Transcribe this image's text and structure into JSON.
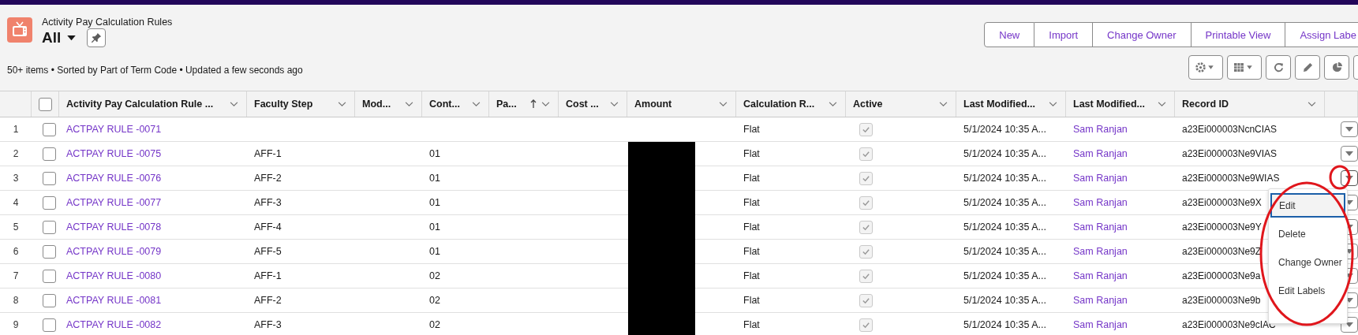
{
  "header": {
    "object_label": "Activity Pay Calculation Rules",
    "list_view": "All"
  },
  "actions": [
    "New",
    "Import",
    "Change Owner",
    "Printable View",
    "Assign Labe"
  ],
  "select_all": {
    "checked": false
  },
  "status": "50+ items • Sorted by Part of Term Code • Updated a few seconds ago",
  "columns": [
    {
      "label": "Activity Pay Calculation Rule ...",
      "sorted": false
    },
    {
      "label": "Faculty Step",
      "sorted": false
    },
    {
      "label": "Mod...",
      "sorted": false
    },
    {
      "label": "Cont...",
      "sorted": false
    },
    {
      "label": "Pa...",
      "sorted": true
    },
    {
      "label": "Cost ...",
      "sorted": false
    },
    {
      "label": "Amount",
      "sorted": false
    },
    {
      "label": "Calculation R...",
      "sorted": false
    },
    {
      "label": "Active",
      "sorted": false
    },
    {
      "label": "Last Modified...",
      "sorted": false
    },
    {
      "label": "Last Modified...",
      "sorted": false
    },
    {
      "label": "Record ID",
      "sorted": false
    }
  ],
  "rows": [
    {
      "num": "1",
      "checked": false,
      "name": "ACTPAY RULE -0071",
      "amount_redacted": false,
      "calc": "Flat",
      "active": true,
      "modified": "5/1/2024 10:35 A...",
      "modified_by": "Sam Ranjan",
      "record_id": "a23Ei000003NcnCIAS",
      "menu_open": false
    },
    {
      "num": "2",
      "checked": false,
      "name": "ACTPAY RULE -0075",
      "faculty_step": "AFF-1",
      "contract": "01",
      "amount_redacted": true,
      "calc": "Flat",
      "active": true,
      "modified": "5/1/2024 10:35 A...",
      "modified_by": "Sam Ranjan",
      "record_id": "a23Ei000003Ne9VIAS",
      "menu_open": false
    },
    {
      "num": "3",
      "checked": false,
      "name": "ACTPAY RULE -0076",
      "faculty_step": "AFF-2",
      "contract": "01",
      "amount_redacted": true,
      "calc": "Flat",
      "active": true,
      "modified": "5/1/2024 10:35 A...",
      "modified_by": "Sam Ranjan",
      "record_id": "a23Ei000003Ne9WIAS",
      "menu_open": true
    },
    {
      "num": "4",
      "checked": false,
      "name": "ACTPAY RULE -0077",
      "faculty_step": "AFF-3",
      "contract": "01",
      "amount_redacted": true,
      "calc": "Flat",
      "active": true,
      "modified": "5/1/2024 10:35 A...",
      "modified_by": "Sam Ranjan",
      "record_id": "a23Ei000003Ne9X",
      "menu_open": false
    },
    {
      "num": "5",
      "checked": false,
      "name": "ACTPAY RULE -0078",
      "faculty_step": "AFF-4",
      "contract": "01",
      "amount_redacted": true,
      "calc": "Flat",
      "active": true,
      "modified": "5/1/2024 10:35 A...",
      "modified_by": "Sam Ranjan",
      "record_id": "a23Ei000003Ne9Y",
      "menu_open": false
    },
    {
      "num": "6",
      "checked": false,
      "name": "ACTPAY RULE -0079",
      "faculty_step": "AFF-5",
      "contract": "01",
      "amount_redacted": true,
      "calc": "Flat",
      "active": true,
      "modified": "5/1/2024 10:35 A...",
      "modified_by": "Sam Ranjan",
      "record_id": "a23Ei000003Ne9Z",
      "menu_open": false
    },
    {
      "num": "7",
      "checked": false,
      "name": "ACTPAY RULE -0080",
      "faculty_step": "AFF-1",
      "contract": "02",
      "amount_redacted": true,
      "calc": "Flat",
      "active": true,
      "modified": "5/1/2024 10:35 A...",
      "modified_by": "Sam Ranjan",
      "record_id": "a23Ei000003Ne9a",
      "menu_open": false
    },
    {
      "num": "8",
      "checked": false,
      "name": "ACTPAY RULE -0081",
      "faculty_step": "AFF-2",
      "contract": "02",
      "amount_redacted": true,
      "calc": "Flat",
      "active": true,
      "modified": "5/1/2024 10:35 A...",
      "modified_by": "Sam Ranjan",
      "record_id": "a23Ei000003Ne9b",
      "menu_open": false
    },
    {
      "num": "9",
      "checked": false,
      "name": "ACTPAY RULE -0082",
      "faculty_step": "AFF-3",
      "contract": "02",
      "amount_redacted": true,
      "calc": "Flat",
      "active": true,
      "modified": "5/1/2024 10:35 A...",
      "modified_by": "Sam Ranjan",
      "record_id": "a23Ei000003Ne9cIAC",
      "menu_open": false
    }
  ],
  "row_menu": [
    {
      "label": "Edit",
      "selected": true
    },
    {
      "label": "Delete",
      "selected": false
    },
    {
      "label": "Change Owner",
      "selected": false
    },
    {
      "label": "Edit Labels",
      "selected": false
    }
  ]
}
